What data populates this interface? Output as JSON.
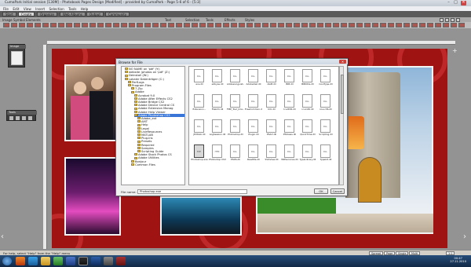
{
  "window": {
    "title": "CumaPark Initial session [130M] - Photobook Pages Design [Modified] - provided by CumaPark - Page 5-6 of 6 - [5:3]",
    "controls": {
      "minimize": "–",
      "maximize": "□",
      "close": "✕"
    }
  },
  "menu": [
    "File",
    "Edit",
    "View",
    "Insert",
    "Selection",
    "Tools",
    "Help"
  ],
  "modes": [
    {
      "label": "Start"
    },
    {
      "label": "Create"
    },
    {
      "label": "Organize"
    },
    {
      "label": "Web Albums"
    },
    {
      "label": "Output"
    },
    {
      "label": "Community"
    }
  ],
  "toolrow": {
    "left": [
      "Image",
      "Symbol",
      "Elements"
    ],
    "mid_labels": [
      "Text",
      "Selection",
      "Tools",
      "Effects",
      "Styles"
    ]
  },
  "left_panel": {
    "title": "Image"
  },
  "tools_panel": {
    "title": "Tools"
  },
  "dialog": {
    "title": "Browse for File",
    "close": "✕",
    "tree": [
      {
        "label": "NO NAME on 'pdf' (Y:)",
        "indent": 1
      },
      {
        "label": "website (photos on 'pdf' (Z:)",
        "indent": 1
      },
      {
        "label": "Deinstall (W:)",
        "indent": 1
      },
      {
        "label": "Lokaler Datenträger (C:)",
        "indent": 1
      },
      {
        "label": "PerfLogs",
        "indent": 2
      },
      {
        "label": "Program Files",
        "indent": 2
      },
      {
        "label": "7-Zip",
        "indent": 3
      },
      {
        "label": "Adobe",
        "indent": 3
      },
      {
        "label": "Acrobat 9.0",
        "indent": 4
      },
      {
        "label": "Adobe After Effects CS2",
        "indent": 4
      },
      {
        "label": "Adobe Bridge CS2",
        "indent": 4
      },
      {
        "label": "Adobe Device Central CS",
        "indent": 4
      },
      {
        "label": "Adobe Extension Manag",
        "indent": 4
      },
      {
        "label": "Adobe Help Viewer",
        "indent": 4
      },
      {
        "label": "Adobe Photoshop CS3",
        "indent": 4,
        "selected": true
      },
      {
        "label": "Adobe_ext",
        "indent": 5
      },
      {
        "label": "AMT",
        "indent": 5
      },
      {
        "label": "Help",
        "indent": 5
      },
      {
        "label": "Legal",
        "indent": 5
      },
      {
        "label": "LiveResources",
        "indent": 5
      },
      {
        "label": "MATLAB",
        "indent": 5
      },
      {
        "label": "Plug-Ins",
        "indent": 5
      },
      {
        "label": "Presets",
        "indent": 5
      },
      {
        "label": "Required",
        "indent": 5
      },
      {
        "label": "Samples",
        "indent": 5
      },
      {
        "label": "Scripting Guide",
        "indent": 5
      },
      {
        "label": "Adobe Stock Photos CS",
        "indent": 4
      },
      {
        "label": "Adobe Utilities",
        "indent": 4
      },
      {
        "label": "Bonjour",
        "indent": 3
      },
      {
        "label": "Common Files",
        "indent": 3
      }
    ],
    "files": [
      {
        "name": "ace.dll",
        "ext": "DLL"
      },
      {
        "name": "adbyas.dll",
        "ext": "DLL"
      },
      {
        "name": "AdobeLinguist...",
        "ext": "DLL"
      },
      {
        "name": "AdobeOwl.dll",
        "ext": "DLL"
      },
      {
        "name": "AGM.dll",
        "ext": "DLL"
      },
      {
        "name": "BIB.dll",
        "ext": "DLL"
      },
      {
        "name": "BIBUtils.dll",
        "ext": "DLL"
      },
      {
        "name": "CoolType.dll",
        "ext": "DLL"
      },
      {
        "name": "Extension...",
        "ext": "DLL"
      },
      {
        "name": "FileInfo.dll",
        "ext": "DLL"
      },
      {
        "name": "FMP_Tool_Ima...",
        "ext": "DLL"
      },
      {
        "name": "FreeCommon.dll",
        "ext": "DLL"
      },
      {
        "name": "ICU.dll",
        "ext": "DLL"
      },
      {
        "name": "Icudt36.dll",
        "ext": "DLL"
      },
      {
        "name": "icuin36.dll",
        "ext": "DLL"
      },
      {
        "name": "icuuc36.dll",
        "ext": "DLL"
      },
      {
        "name": "JP2KLib.dll",
        "ext": "DLL"
      },
      {
        "name": "LogSession.dll",
        "ext": "DLL"
      },
      {
        "name": "Photoshop.dll",
        "ext": "DLL"
      },
      {
        "name": "Plugin.dll",
        "ext": "DLL"
      },
      {
        "name": "PSArt.dll",
        "ext": "DLL"
      },
      {
        "name": "PSViews.dll",
        "ext": "DLL"
      },
      {
        "name": "QuickTime.dll",
        "ext": "DLL"
      },
      {
        "name": "Scripting.dll",
        "ext": "DLL"
      },
      {
        "name": "Photoshop.exe",
        "ext": "EXE"
      },
      {
        "name": "Photoshop CS3 Read Me",
        "ext": "HTM"
      },
      {
        "name": "PSDS.dll",
        "ext": "DLL"
      },
      {
        "name": "ReadMe.dll",
        "ext": "DLL"
      },
      {
        "name": "SVGView.dll",
        "ext": "DLL"
      },
      {
        "name": "WRServices.dll",
        "ext": "DLL"
      },
      {
        "name": "TypeLibrary.dll",
        "ext": "DLL"
      },
      {
        "name": "Typekit.dll",
        "ext": "DLL"
      }
    ],
    "filename_label": "File name:",
    "filename_value": "Photoshop.exe",
    "ok": "OK",
    "cancel": "Cancel"
  },
  "status": {
    "text": "For help, select \"Help\" from the \"Help\" menu",
    "page_buttons": [
      "Spread",
      "Page",
      "Single",
      "Multi"
    ],
    "zoom": "1:1"
  },
  "taskbar": {
    "clock_time": "00:47",
    "clock_date": "27.11.2010"
  },
  "colors": {
    "page_red": "#a01313",
    "selection": "#3875d6",
    "taskbar": "#1a365a"
  }
}
